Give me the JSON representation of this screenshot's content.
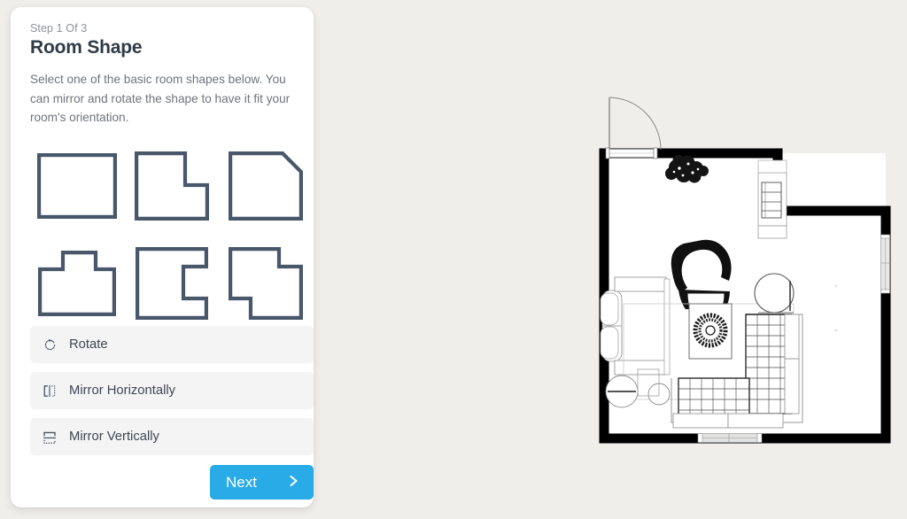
{
  "background_color": "#efeeea",
  "panel": {
    "step_label": "Step 1 Of 3",
    "title": "Room Shape",
    "description": "Select one of the basic room shapes below. You can mirror and rotate the shape to have it fit your room's orientation.",
    "card_color": "#ffffff",
    "title_color": "#2f3b47",
    "desc_color": "#6e747c"
  },
  "shapes": {
    "stroke_color": "#48576a",
    "items": [
      {
        "id": "rectangle",
        "name": "rectangle-shape",
        "selected": false
      },
      {
        "id": "l-shape",
        "name": "l-shape",
        "selected": false
      },
      {
        "id": "chamfered",
        "name": "chamfered-corner-shape",
        "selected": false
      },
      {
        "id": "t-shape",
        "name": "t-shape",
        "selected": false
      },
      {
        "id": "c-shape",
        "name": "c-shape",
        "selected": false
      },
      {
        "id": "z-shape",
        "name": "z-shape",
        "selected": false
      }
    ]
  },
  "actions": [
    {
      "label": "Rotate",
      "icon": "rotate-icon",
      "bg": "#f4f4f5"
    },
    {
      "label": "Mirror Horizontally",
      "icon": "mirror-horizontal-icon",
      "bg": "#f4f4f5"
    },
    {
      "label": "Mirror Vertically",
      "icon": "mirror-vertical-icon",
      "bg": "#f4f4f5"
    }
  ],
  "next_button": {
    "label": "Next",
    "icon": "chevron-right-icon",
    "color": "#29abe8",
    "text_color": "#ffffff"
  },
  "floorplan": {
    "name": "room-floor-plan-preview",
    "room_shape": "l-shape",
    "wall_color": "#000000",
    "floor_color": "#ffffff",
    "features": [
      {
        "name": "entry-door",
        "wall": "top",
        "type": "door-with-swing-arc"
      },
      {
        "name": "right-wall-window",
        "wall": "right",
        "type": "window"
      },
      {
        "name": "bottom-wall-window",
        "wall": "bottom",
        "type": "window"
      }
    ],
    "furniture": [
      {
        "name": "potted-plant",
        "type": "plant"
      },
      {
        "name": "bookshelf-unit",
        "type": "shelving"
      },
      {
        "name": "armchair",
        "type": "chair"
      },
      {
        "name": "sofa",
        "type": "sofa"
      },
      {
        "name": "coffee-table",
        "type": "table"
      },
      {
        "name": "round-side-table",
        "type": "table"
      },
      {
        "name": "round-stool",
        "type": "stool"
      },
      {
        "name": "sectional-sofa",
        "type": "sectional"
      },
      {
        "name": "area-rug",
        "type": "rug"
      }
    ]
  }
}
